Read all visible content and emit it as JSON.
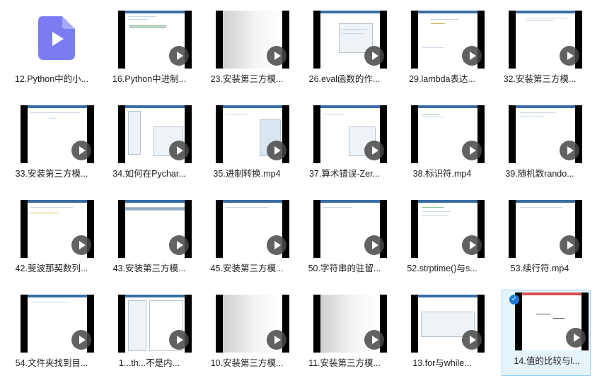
{
  "rows": [
    [
      {
        "label": "12.Python中的小...",
        "kind": "file"
      },
      {
        "label": "16.Python中进制...",
        "kind": "video"
      },
      {
        "label": "23.安装第三方模...",
        "kind": "gray"
      },
      {
        "label": "26.eval函数的作...",
        "kind": "video"
      },
      {
        "label": "29.lambda表达...",
        "kind": "video"
      },
      {
        "label": "32.安装第三方模...",
        "kind": "video"
      }
    ],
    [
      {
        "label": "33.安装第三方模...",
        "kind": "video"
      },
      {
        "label": "34.如何在Pychar...",
        "kind": "video"
      },
      {
        "label": "35.进制转换.mp4",
        "kind": "video"
      },
      {
        "label": "37.算术错误-Zer...",
        "kind": "video"
      },
      {
        "label": "38.标识符.mp4",
        "kind": "video"
      },
      {
        "label": "39.随机数rando...",
        "kind": "video"
      }
    ],
    [
      {
        "label": "42.斐波那契数列...",
        "kind": "video"
      },
      {
        "label": "43.安装第三方模...",
        "kind": "video"
      },
      {
        "label": "45.安装第三方模...",
        "kind": "video"
      },
      {
        "label": "50.字符串的驻留...",
        "kind": "video"
      },
      {
        "label": "52.strptime()与s...",
        "kind": "video"
      },
      {
        "label": "53.续行符.mp4",
        "kind": "video"
      }
    ],
    [
      {
        "label": "54.文件夹找到目...",
        "kind": "video"
      },
      {
        "label": "1...th...不是内...",
        "kind": "video"
      },
      {
        "label": "10.安装第三方模...",
        "kind": "gray"
      },
      {
        "label": "11.安装第三方模...",
        "kind": "gray"
      },
      {
        "label": "13.for与while...",
        "kind": "video"
      },
      {
        "label": "14.值的比较与l...",
        "kind": "video",
        "selected": true
      }
    ]
  ],
  "colors": {
    "accent": "#1a7bd6",
    "file_icon": "#7b7cf2",
    "selection_bg": "#e5f3fb"
  },
  "icons": {
    "file": "video-file-icon",
    "play": "play-icon",
    "check": "check-icon"
  }
}
